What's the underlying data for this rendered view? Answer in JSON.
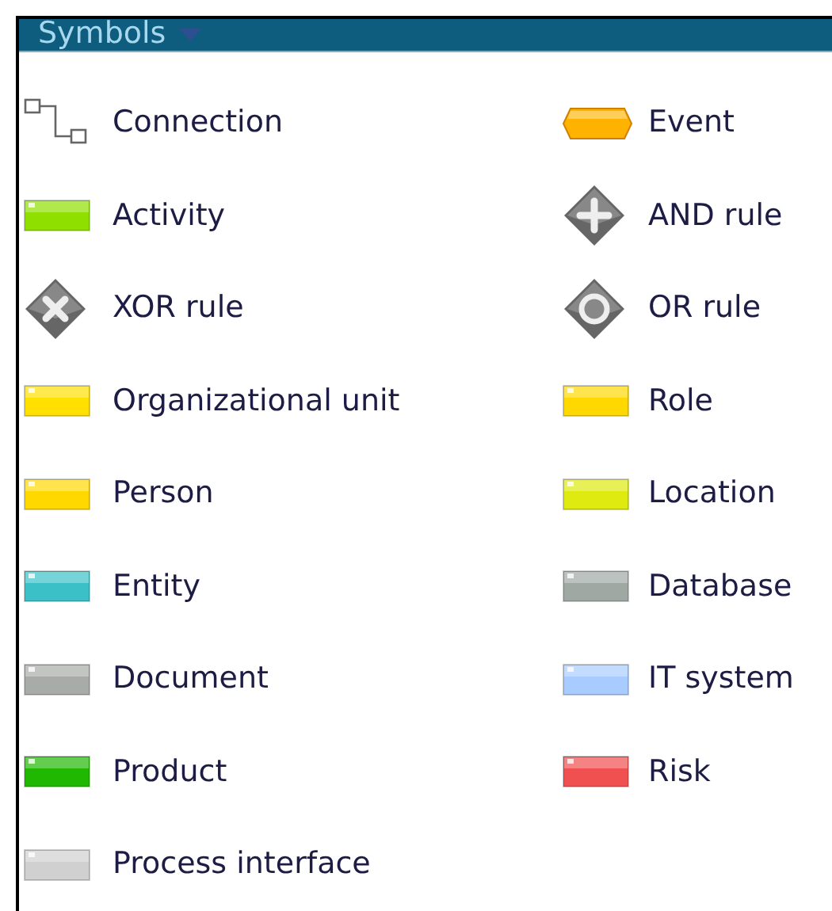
{
  "panel": {
    "title": "Symbols"
  },
  "items": [
    {
      "label": "Connection",
      "kind": "connection"
    },
    {
      "label": "Event",
      "kind": "event",
      "color": "#ffb300"
    },
    {
      "label": "Activity",
      "kind": "rectangle",
      "color": "#8fe000"
    },
    {
      "label": "AND rule",
      "kind": "and"
    },
    {
      "label": "XOR rule",
      "kind": "xor"
    },
    {
      "label": "OR rule",
      "kind": "or"
    },
    {
      "label": "Organizational unit",
      "kind": "rectangle",
      "color": "#ffe000"
    },
    {
      "label": "Role",
      "kind": "rectangle",
      "color": "#ffd800"
    },
    {
      "label": "Person",
      "kind": "rectangle",
      "color": "#ffd800"
    },
    {
      "label": "Location",
      "kind": "rectangle",
      "color": "#dfea10"
    },
    {
      "label": "Entity",
      "kind": "rectangle",
      "color": "#3cc0c8"
    },
    {
      "label": "Database",
      "kind": "rectangle",
      "color": "#a0a8a4"
    },
    {
      "label": "Document",
      "kind": "rectangle",
      "color": "#a8aca8"
    },
    {
      "label": "IT system",
      "kind": "rectangle",
      "color": "#a8ccff"
    },
    {
      "label": "Product",
      "kind": "rectangle",
      "color": "#20b800"
    },
    {
      "label": "Risk",
      "kind": "rectangle",
      "color": "#f05050"
    },
    {
      "label": "Process interface",
      "kind": "rectangle",
      "color": "#d0d0d0"
    }
  ]
}
